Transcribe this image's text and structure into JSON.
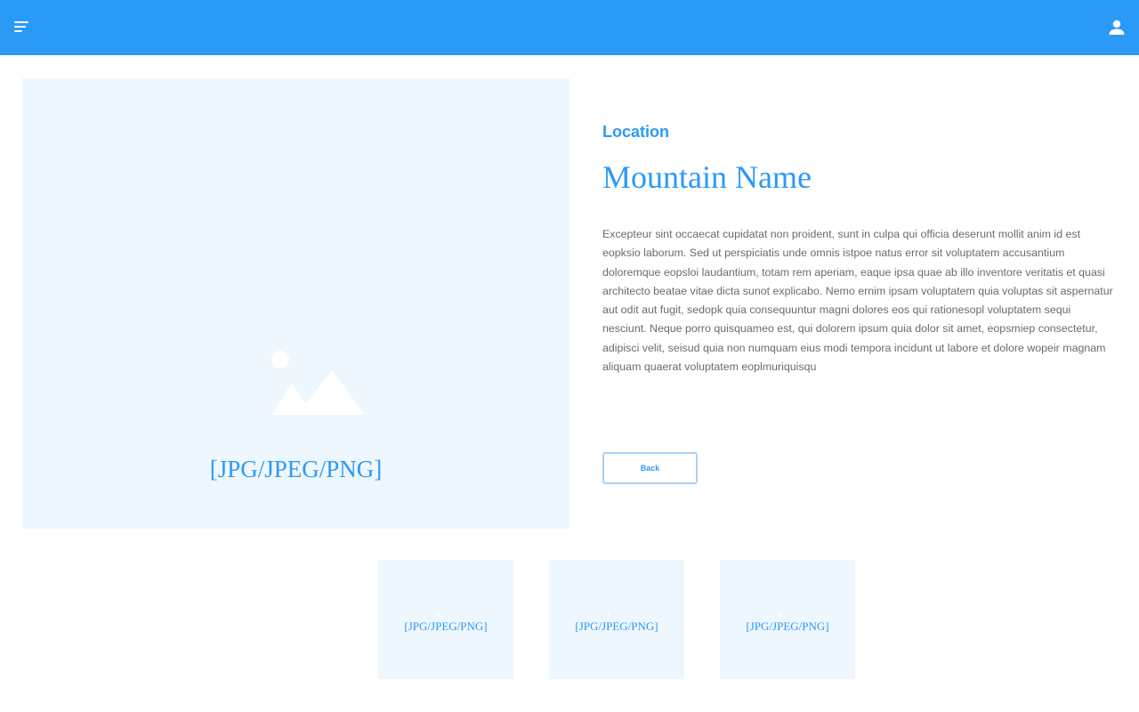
{
  "header": {
    "menu_icon": "menu-icon",
    "user_icon": "user-icon",
    "background_color": "#2b9af7"
  },
  "hero": {
    "placeholder_icon": "image-placeholder-icon",
    "label": "[JPG/JPEG/PNG]"
  },
  "details": {
    "location": "Location",
    "title": "Mountain Name",
    "description": "Excepteur sint occaecat cupidatat non proident, sunt in culpa qui officia deserunt mollit anim id est eopksio laborum. Sed ut perspiciatis unde omnis istpoe natus error sit voluptatem accusantium doloremque eopsloi laudantium, totam rem aperiam, eaque ipsa quae ab illo inventore veritatis et quasi architecto beatae vitae dicta sunot explicabo. Nemo ernim ipsam voluptatem quia voluptas sit aspernatur aut odit aut fugit, sedopk quia consequuntur magni dolores eos qui rationesopl voluptatem sequi nesciunt. Neque porro quisquameo est, qui dolorem ipsum quia dolor sit amet, eopsmiep consectetur, adipisci velit, seisud quia non numquam eius modi tempora incidunt ut labore et dolore wopeir magnam aliquam quaerat voluptatem eoplmuriquisqu",
    "back_label": "Back"
  },
  "thumbnails": [
    {
      "label": "[JPG/JPEG/PNG]"
    },
    {
      "label": "[JPG/JPEG/PNG]"
    },
    {
      "label": "[JPG/JPEG/PNG]"
    }
  ],
  "colors": {
    "accent": "#2b9af7",
    "placeholder_bg": "#eef6fe",
    "body_text": "#6b6b6b"
  }
}
